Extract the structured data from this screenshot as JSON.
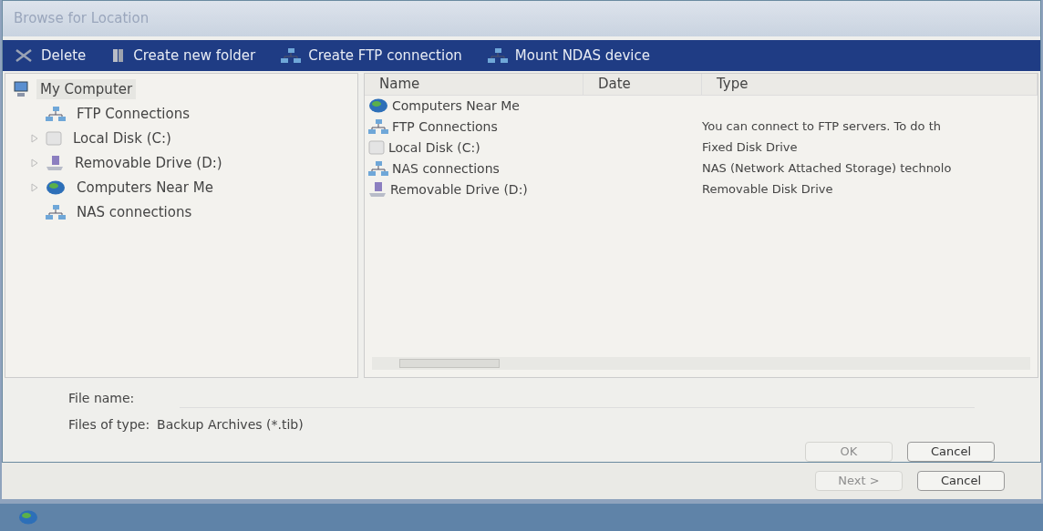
{
  "window": {
    "title": "Browse for Location"
  },
  "toolbar": [
    {
      "label": "Delete",
      "kind": "delete"
    },
    {
      "label": "Create new folder",
      "kind": "folder"
    },
    {
      "label": "Create FTP connection",
      "kind": "network"
    },
    {
      "label": "Mount NDAS device",
      "kind": "network"
    }
  ],
  "tree": [
    {
      "label": "My Computer",
      "kind": "computer",
      "selected": true,
      "children": [
        {
          "label": "FTP Connections",
          "kind": "network",
          "selected": false,
          "expandable": false
        },
        {
          "label": "Local Disk (C:)",
          "kind": "disk",
          "selected": false,
          "expandable": true
        },
        {
          "label": "Removable Drive (D:)",
          "kind": "removable",
          "selected": false,
          "expandable": true
        },
        {
          "label": "Computers Near Me",
          "kind": "globe",
          "selected": false,
          "expandable": true
        },
        {
          "label": "NAS connections",
          "kind": "network",
          "selected": false,
          "expandable": false
        }
      ]
    }
  ],
  "table": {
    "columns": [
      "Name",
      "Date",
      "Type"
    ],
    "rows": [
      {
        "name": "Computers Near Me",
        "kind": "globe"
      },
      {
        "name": "FTP Connections",
        "kind": "network",
        "type": "You can connect to FTP servers. To do th"
      },
      {
        "name": "Local Disk (C:)",
        "kind": "disk",
        "type": "Fixed Disk Drive"
      },
      {
        "name": "NAS connections",
        "kind": "network",
        "type": "NAS (Network Attached Storage) technolo"
      },
      {
        "name": "Removable Drive (D:)",
        "kind": "removable",
        "type": "Removable Disk Drive"
      }
    ]
  },
  "file_name": {
    "label": "File name:"
  },
  "files_of_type": {
    "label": "Files of type:",
    "value": "Backup Archives (*.tib)"
  },
  "buttons": [
    {
      "label": "OK",
      "disabled": true
    },
    {
      "label": "Cancel",
      "disabled": false
    }
  ],
  "background_buttons": [
    {
      "label": "Next >",
      "disabled": true
    },
    {
      "label": "Cancel",
      "disabled": false
    }
  ]
}
